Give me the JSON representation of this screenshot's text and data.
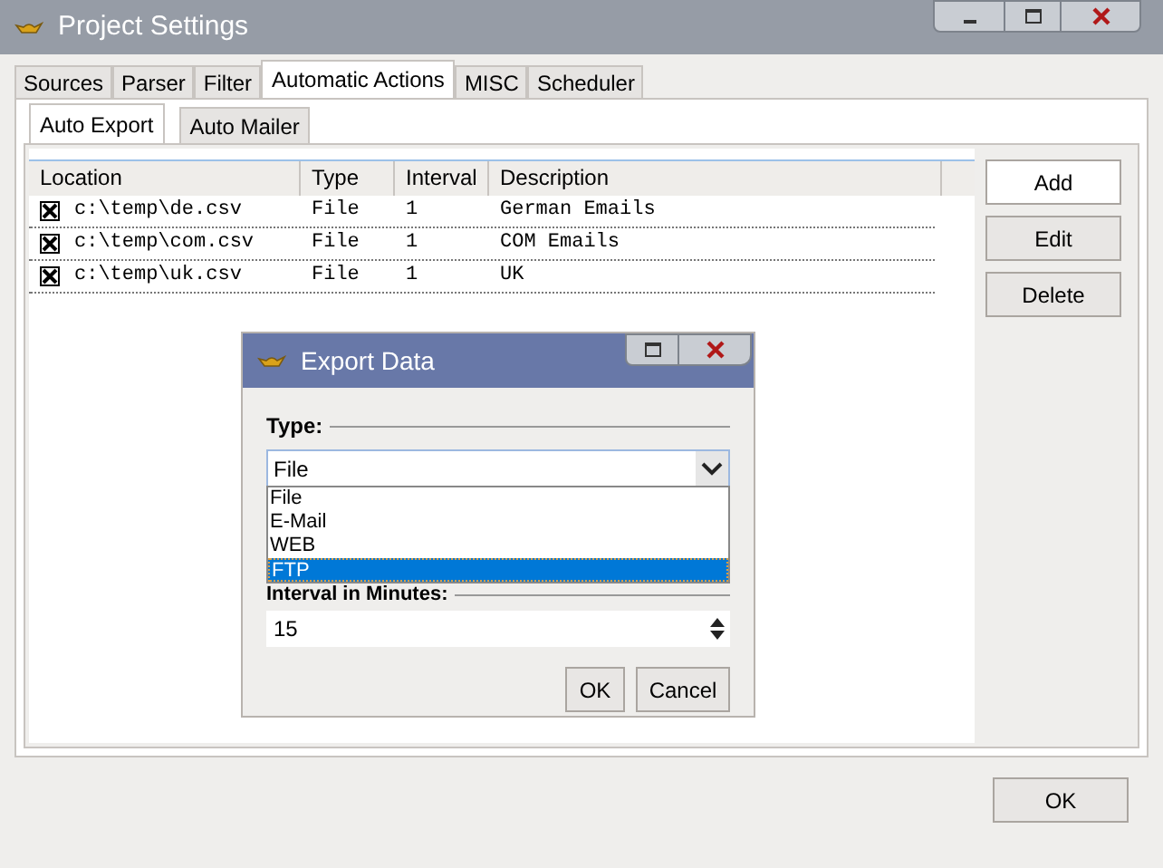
{
  "window": {
    "title": "Project Settings"
  },
  "tabs": [
    {
      "label": "Sources",
      "selected": false
    },
    {
      "label": "Parser",
      "selected": false
    },
    {
      "label": "Filter",
      "selected": false
    },
    {
      "label": "Automatic Actions",
      "selected": true
    },
    {
      "label": "MISC",
      "selected": false
    },
    {
      "label": "Scheduler",
      "selected": false
    }
  ],
  "subtabs": [
    {
      "label": "Auto Export",
      "selected": true
    },
    {
      "label": "Auto Mailer",
      "selected": false
    }
  ],
  "table": {
    "columns": [
      "Location",
      "Type",
      "Interval",
      "Description"
    ],
    "rows": [
      {
        "checked": true,
        "cells": [
          "c:\\temp\\de.csv",
          "File",
          "1",
          "German Emails"
        ]
      },
      {
        "checked": true,
        "cells": [
          "c:\\temp\\com.csv",
          "File",
          "1",
          "COM Emails"
        ]
      },
      {
        "checked": true,
        "cells": [
          "c:\\temp\\uk.csv",
          "File",
          "1",
          "UK"
        ]
      }
    ]
  },
  "side_buttons": [
    "Add",
    "Edit",
    "Delete"
  ],
  "ok_button": "OK",
  "dialog": {
    "title": "Export Data",
    "type_label": "Type:",
    "type_value": "File",
    "options": [
      {
        "label": "File",
        "selected": false
      },
      {
        "label": "E-Mail",
        "selected": false
      },
      {
        "label": "WEB",
        "selected": false
      },
      {
        "label": "FTP",
        "selected": true
      }
    ],
    "interval_label": "Interval in Minutes:",
    "interval_value": "15",
    "buttons": [
      "OK",
      "Cancel"
    ]
  }
}
